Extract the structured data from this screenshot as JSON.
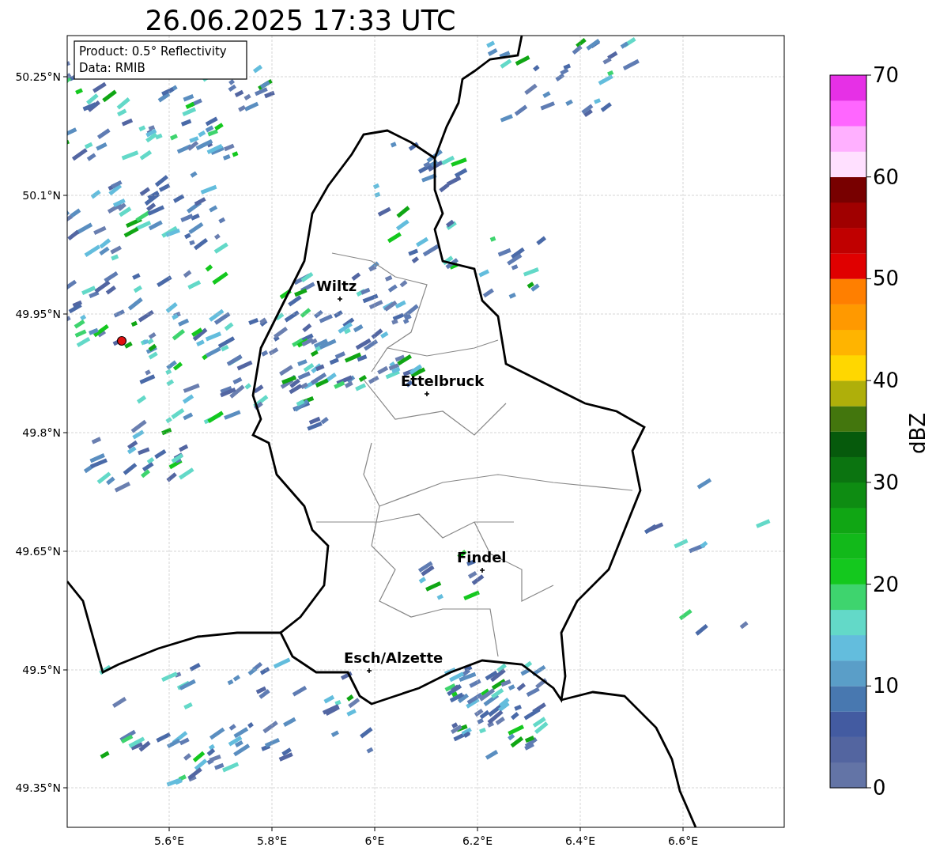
{
  "title": "26.06.2025 17:33 UTC",
  "info_box": [
    "Product: 0.5° Reflectivity",
    "Data: RMIB"
  ],
  "map": {
    "xticks": [
      "5.6°E",
      "5.8°E",
      "6°E",
      "6.2°E",
      "6.4°E",
      "6.6°E"
    ],
    "yticks": [
      "50.25°N",
      "50.1°N",
      "49.95°N",
      "49.8°N",
      "49.65°N",
      "49.5°N",
      "49.35°N"
    ],
    "cities": [
      "Wiltz",
      "Ettelbruck",
      "Findel",
      "Esch/Alzette"
    ]
  },
  "colorbar": {
    "label": "dBZ",
    "ticks": [
      "70",
      "60",
      "50",
      "40",
      "30",
      "20",
      "10",
      "0"
    ],
    "segments": [
      {
        "color": "#6374a6"
      },
      {
        "color": "#5365a0"
      },
      {
        "color": "#435ba1"
      },
      {
        "color": "#4878b0"
      },
      {
        "color": "#5a9ec8"
      },
      {
        "color": "#63bddd"
      },
      {
        "color": "#63d9c8"
      },
      {
        "color": "#3ed46e"
      },
      {
        "color": "#14c81e"
      },
      {
        "color": "#12b91a"
      },
      {
        "color": "#10a614"
      },
      {
        "color": "#0e8c12"
      },
      {
        "color": "#0b7410"
      },
      {
        "color": "#065a0c"
      },
      {
        "color": "#43760d"
      },
      {
        "color": "#afaf0a"
      },
      {
        "color": "#ffd700"
      },
      {
        "color": "#ffb400"
      },
      {
        "color": "#ff9900"
      },
      {
        "color": "#ff7f00"
      },
      {
        "color": "#e00000"
      },
      {
        "color": "#c00000"
      },
      {
        "color": "#a00000"
      },
      {
        "color": "#780000"
      },
      {
        "color": "#ffe0ff"
      },
      {
        "color": "#ffb0ff"
      },
      {
        "color": "#ff66ff"
      },
      {
        "color": "#e630e6"
      }
    ]
  }
}
